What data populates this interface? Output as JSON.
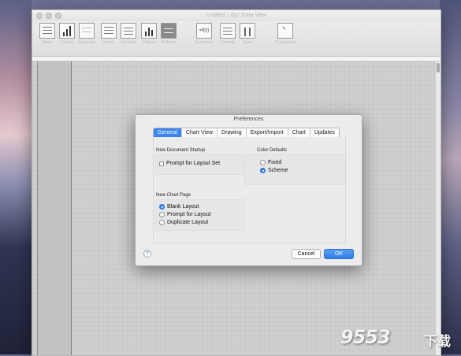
{
  "window": {
    "title": "Untitled 1.dg7:Data View"
  },
  "toolbar": {
    "items": [
      {
        "label": "Data",
        "icon": "data-table-icon"
      },
      {
        "label": "Charts",
        "icon": "bar-chart-icon"
      },
      {
        "label": "Organize",
        "icon": "organize-icon"
      },
      {
        "label": "Insert",
        "icon": "insert-icon"
      },
      {
        "label": "Variable",
        "icon": "variable-icon"
      },
      {
        "label": "Object",
        "icon": "object-chart-icon"
      },
      {
        "label": "Refresh",
        "icon": "refresh-icon"
      },
      {
        "label": "Formulas",
        "icon": "formula-fx-icon",
        "glyph": "=f(x)"
      },
      {
        "label": "Format",
        "icon": "format-icon"
      },
      {
        "label": "Sort",
        "icon": "sort-icon"
      },
      {
        "label": "Transpose",
        "icon": "transpose-icon"
      }
    ]
  },
  "dialog": {
    "title": "Preferences",
    "tabs": [
      "General",
      "Chart View",
      "Drawing",
      "Export/Import",
      "Chart",
      "Updates"
    ],
    "active_tab": "General",
    "new_document_startup": {
      "heading": "New Document Startup",
      "prompt_for_layout_set": {
        "label": "Prompt for Layout Set",
        "checked": false
      }
    },
    "color_defaults": {
      "heading": "Color Defaults",
      "options": [
        "Fixed",
        "Scheme"
      ],
      "selected": "Scheme"
    },
    "new_chart_page": {
      "heading": "New Chart Page",
      "options": [
        "Blank Layout",
        "Prompt for Layout",
        "Duplicate Layout"
      ],
      "selected": "Blank Layout"
    },
    "help_glyph": "?",
    "cancel_label": "Cancel",
    "ok_label": "OK"
  },
  "watermark": {
    "digits": "9553",
    "suffix": "下载"
  },
  "colors": {
    "accent": "#3b86f0",
    "window_bg": "#ececec"
  }
}
